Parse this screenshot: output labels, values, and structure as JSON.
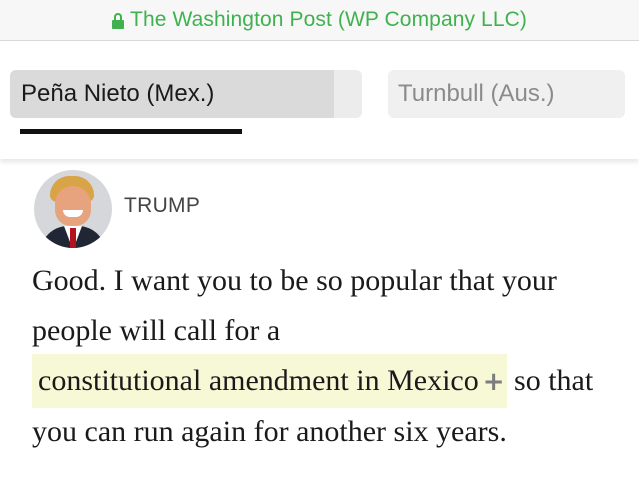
{
  "browser": {
    "url_label": "The Washington Post (WP Company LLC)",
    "lock_icon": "lock-icon",
    "secure_color": "#3fb24f"
  },
  "tabs": [
    {
      "label": "Peña Nieto (Mex.)",
      "active": true
    },
    {
      "label": "Turnbull (Aus.)",
      "active": false
    }
  ],
  "transcript": {
    "speaker": "TRUMP",
    "quote_before": "Good. I want you to be so popular that your people will call for a",
    "highlight": "constitutional amendment in Mexico",
    "expand_icon": "plus-icon",
    "quote_after": "so that you can run again for another six years.",
    "highlight_color": "#f7f8d6"
  }
}
